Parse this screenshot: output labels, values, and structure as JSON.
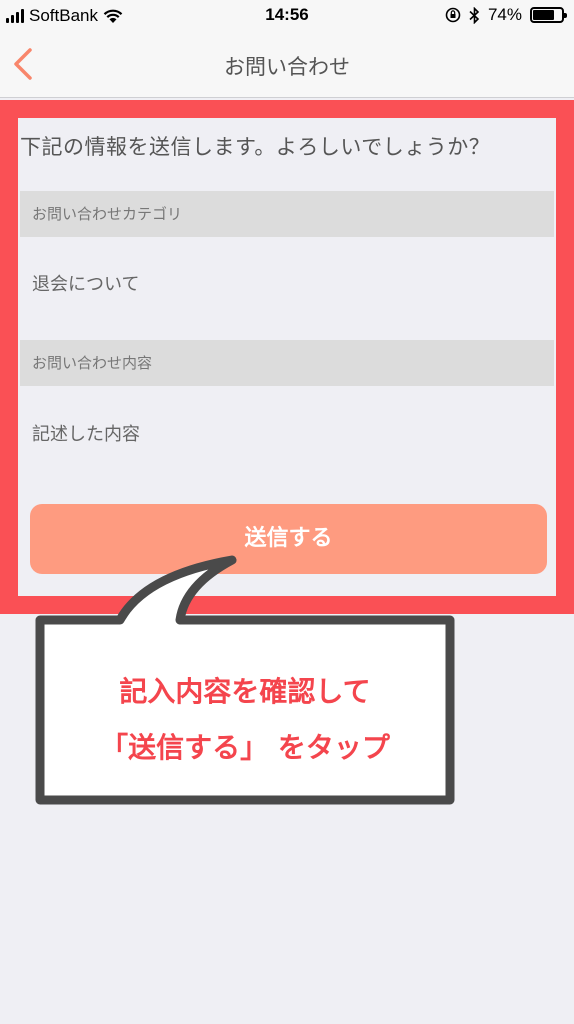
{
  "status_bar": {
    "carrier": "SoftBank",
    "time": "14:56",
    "battery_percent": "74%",
    "battery_level": 0.74
  },
  "nav": {
    "title": "お問い合わせ",
    "back_icon": "chevron-left-icon"
  },
  "form": {
    "confirm_message": "下記の情報を送信します。よろしいでしょうか？",
    "category_label": "お問い合わせカテゴリ",
    "category_value": "退会について",
    "content_label": "お問い合わせ内容",
    "content_value": "記述した内容",
    "send_button_label": "送信する"
  },
  "callout": {
    "line1": "記入内容を確認して",
    "line2": "「送信する」 をタップ"
  },
  "colors": {
    "accent": "#fe9b80",
    "highlight": "#fa5055",
    "back_arrow": "#f8866b",
    "callout_text": "#f4454d"
  }
}
